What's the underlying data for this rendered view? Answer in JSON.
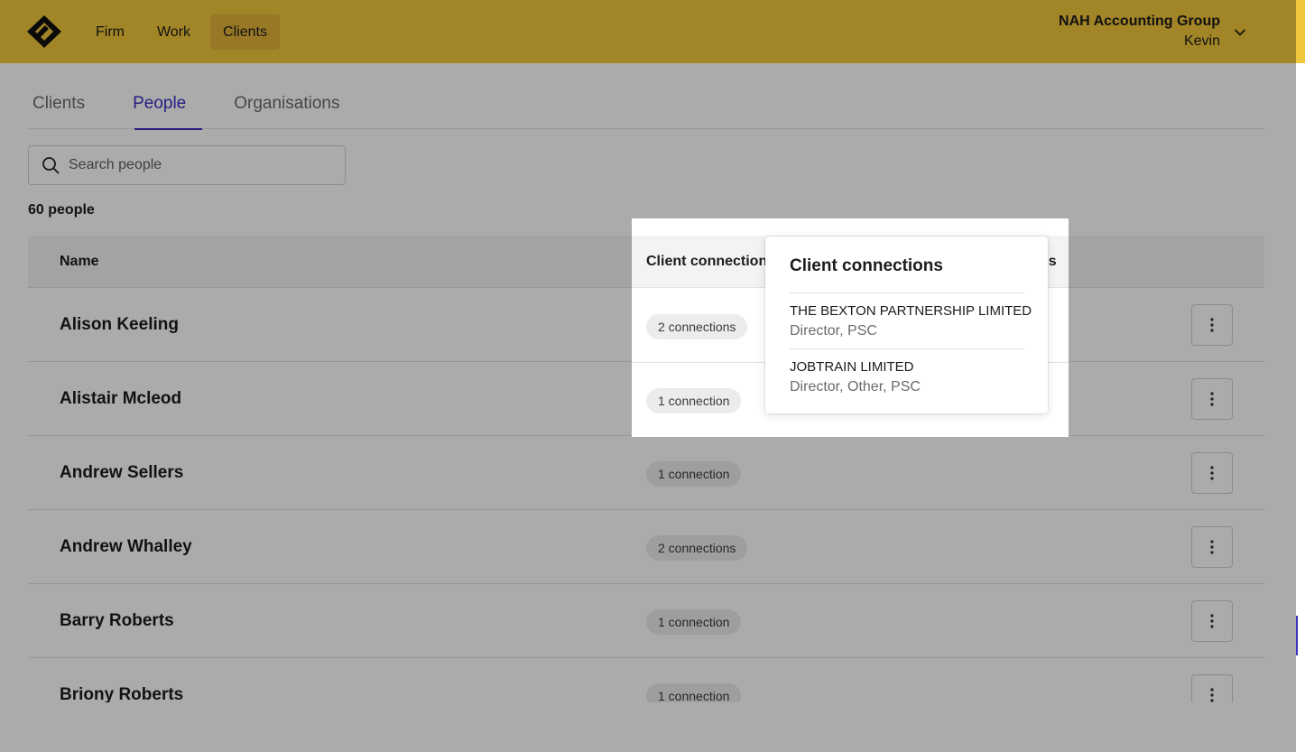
{
  "header": {
    "logo": "firm-logo",
    "nav": [
      "Firm",
      "Work",
      "Clients"
    ],
    "active_nav": "Clients",
    "org_name": "NAH Accounting Group",
    "user_name": "Kevin",
    "colors": {
      "brand": "#f0c63a",
      "active_nav": "#e3b33a",
      "accent": "#3b2fc4"
    }
  },
  "tabs": [
    "Clients",
    "People",
    "Organisations"
  ],
  "active_tab": "People",
  "search": {
    "placeholder": "Search people",
    "value": ""
  },
  "summary": {
    "count_label": "60 people"
  },
  "table": {
    "columns": {
      "name": "Name",
      "connections": "Client connection",
      "status_fragment": "us"
    },
    "rows": [
      {
        "name": "Alison Keeling",
        "connections": "2 connections"
      },
      {
        "name": "Alistair Mcleod",
        "connections": "1 connection"
      },
      {
        "name": "Andrew Sellers",
        "connections": "1 connection"
      },
      {
        "name": "Andrew Whalley",
        "connections": "2 connections"
      },
      {
        "name": "Barry Roberts",
        "connections": "1 connection"
      },
      {
        "name": "Briony Roberts",
        "connections": "1 connection"
      }
    ]
  },
  "popover": {
    "title": "Client connections",
    "items": [
      {
        "company": "THE BEXTON PARTNERSHIP LIMITED",
        "roles": "Director, PSC"
      },
      {
        "company": "JOBTRAIN LIMITED",
        "roles": "Director, Other, PSC"
      }
    ]
  }
}
